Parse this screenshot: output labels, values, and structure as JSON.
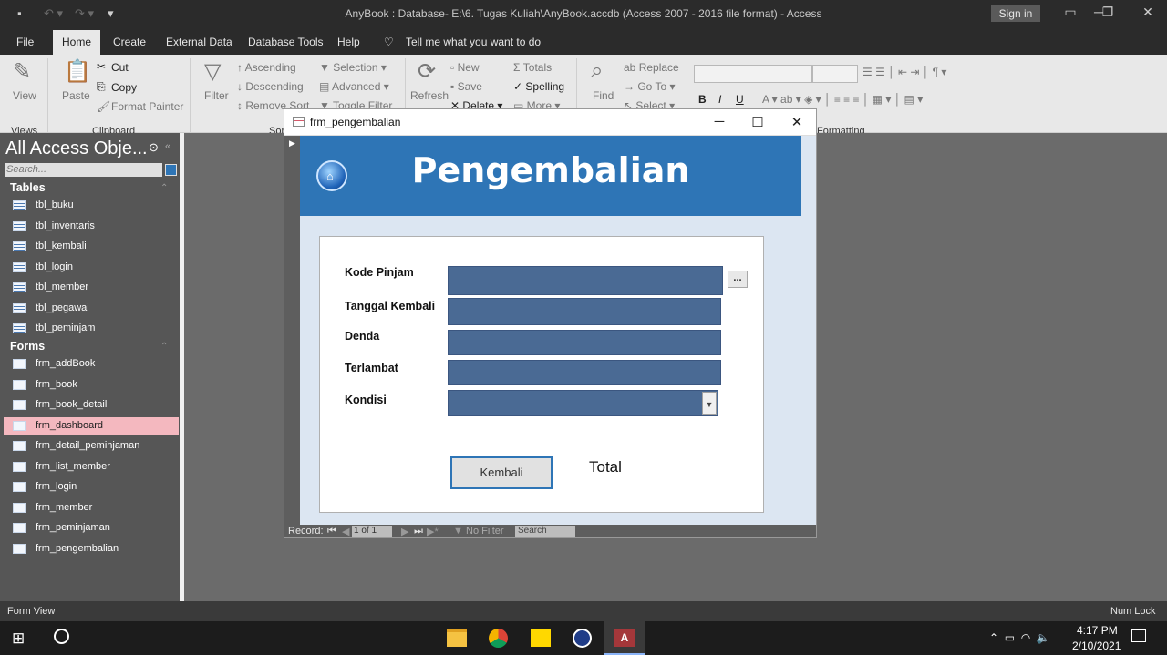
{
  "app": {
    "title": "AnyBook : Database- E:\\6. Tugas Kuliah\\AnyBook.accdb (Access 2007 - 2016 file format)  -  Access",
    "sign_in": "Sign in"
  },
  "menu": {
    "file": "File",
    "tabs": [
      "Home",
      "Create",
      "External Data",
      "Database Tools",
      "Help"
    ],
    "tell_me": "Tell me what you want to do"
  },
  "ribbon": {
    "views": {
      "view": "View",
      "group": "Views"
    },
    "clipboard": {
      "paste": "Paste",
      "cut": "Cut",
      "copy": "Copy",
      "format_painter": "Format Painter",
      "group": "Clipboard"
    },
    "sort_filter": {
      "filter": "Filter",
      "ascending": "Ascending",
      "descending": "Descending",
      "remove_sort": "Remove Sort",
      "selection": "Selection",
      "advanced": "Advanced",
      "toggle_filter": "Toggle Filter",
      "group": "Sor"
    },
    "records": {
      "refresh": "Refresh",
      "new": "New",
      "save": "Save",
      "delete": "Delete",
      "totals": "Totals",
      "spelling": "Spelling",
      "more": "More"
    },
    "find": {
      "find": "Find",
      "replace": "Replace",
      "go_to": "Go To",
      "select": "Select"
    },
    "formatting": {
      "bold": "B",
      "italic": "I",
      "underline": "U",
      "group": "Formatting"
    }
  },
  "nav": {
    "title": "All Access Obje...",
    "search_placeholder": "Search...",
    "tables_header": "Tables",
    "tables": [
      "tbl_buku",
      "tbl_inventaris",
      "tbl_kembali",
      "tbl_login",
      "tbl_member",
      "tbl_pegawai",
      "tbl_peminjam"
    ],
    "forms_header": "Forms",
    "forms": [
      "frm_addBook",
      "frm_book",
      "frm_book_detail",
      "frm_dashboard",
      "frm_detail_peminjaman",
      "frm_list_member",
      "frm_login",
      "frm_member",
      "frm_peminjaman",
      "frm_pengembalian"
    ],
    "selected_form": "frm_dashboard"
  },
  "form": {
    "window_title": "frm_pengembalian",
    "header_title": "Pengembalian",
    "labels": {
      "kode_pinjam": "Kode Pinjam",
      "tanggal_kembali": "Tanggal Kembali",
      "denda": "Denda",
      "terlambat": "Terlambat",
      "kondisi": "Kondisi"
    },
    "lookup_button": "...",
    "kembali_button": "Kembali",
    "total_label": "Total"
  },
  "record_bar": {
    "record_label": "Record:",
    "position": "1 of 1",
    "no_filter": "No Filter",
    "search": "Search"
  },
  "status": {
    "left": "Form View",
    "right": "Num Lock"
  },
  "taskbar": {
    "time": "4:17 PM",
    "date": "2/10/2021"
  },
  "colors": {
    "form_header": "#2e75b6",
    "field_fill": "#4a6a94",
    "selected_nav": "#f4b8bf"
  }
}
